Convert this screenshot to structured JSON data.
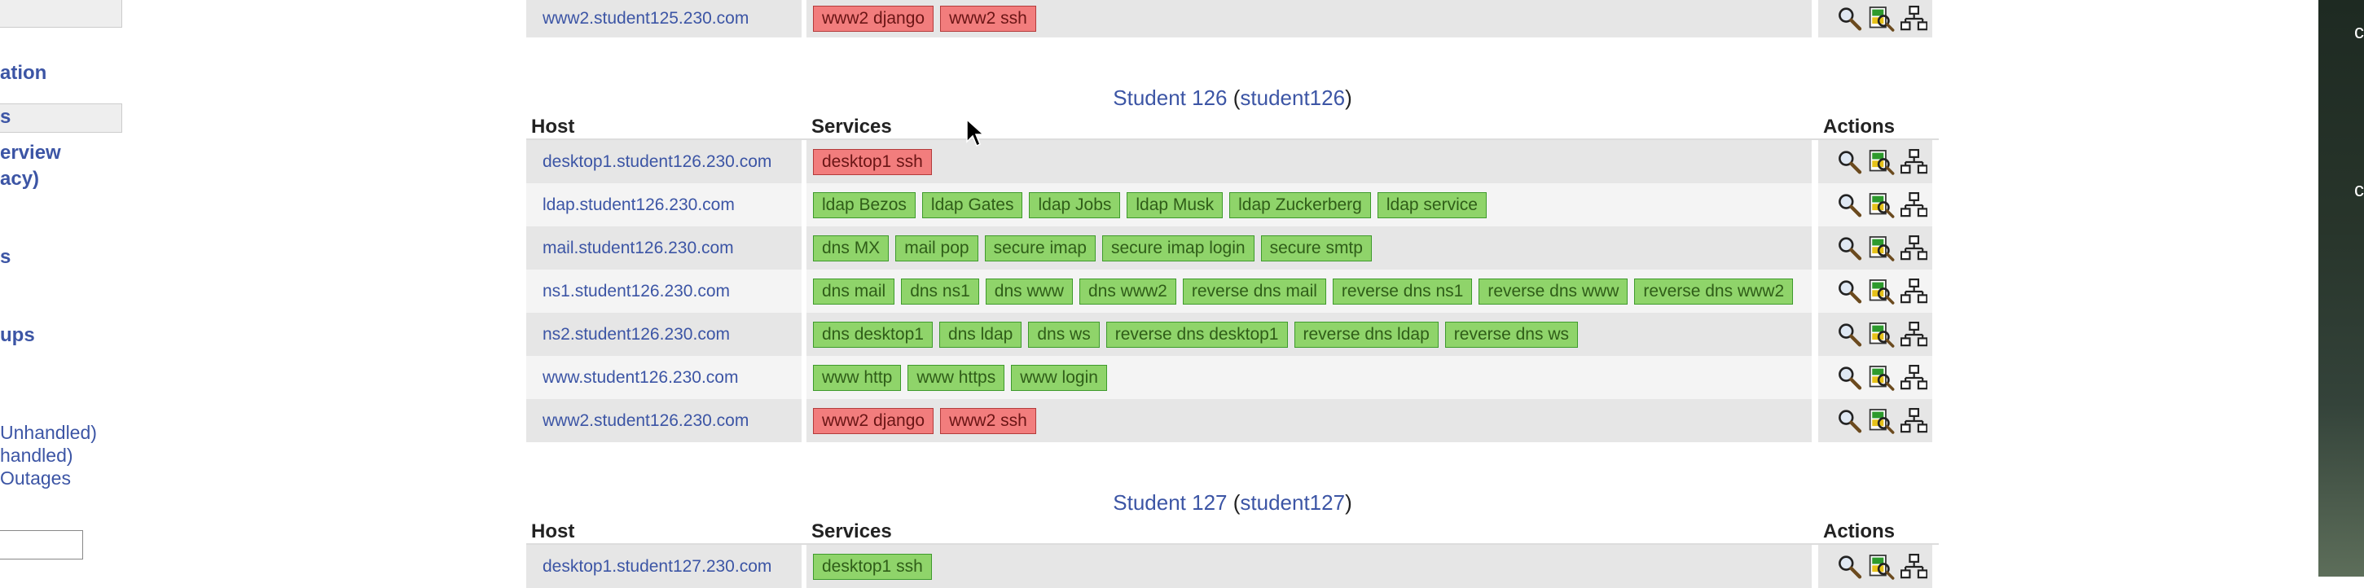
{
  "sidebar": {
    "links": [
      "ation",
      "s",
      "erview",
      "acy)",
      "s",
      "ups"
    ],
    "problems": [
      "Unhandled)",
      "handled)",
      "Outages"
    ]
  },
  "columns": {
    "host": "Host",
    "services": "Services",
    "actions": "Actions"
  },
  "top_row": {
    "host": "www2.student125.230.com",
    "services": [
      {
        "name": "www2 django",
        "state": "critical"
      },
      {
        "name": "www2 ssh",
        "state": "critical"
      }
    ]
  },
  "groups": [
    {
      "name": "Student 126",
      "alias": "student126",
      "rows": [
        {
          "host": "desktop1.student126.230.com",
          "services": [
            {
              "name": "desktop1 ssh",
              "state": "critical"
            }
          ]
        },
        {
          "host": "ldap.student126.230.com",
          "services": [
            {
              "name": "ldap Bezos",
              "state": "ok"
            },
            {
              "name": "ldap Gates",
              "state": "ok"
            },
            {
              "name": "ldap Jobs",
              "state": "ok"
            },
            {
              "name": "ldap Musk",
              "state": "ok"
            },
            {
              "name": "ldap Zuckerberg",
              "state": "ok"
            },
            {
              "name": "ldap service",
              "state": "ok"
            }
          ]
        },
        {
          "host": "mail.student126.230.com",
          "services": [
            {
              "name": "dns MX",
              "state": "ok"
            },
            {
              "name": "mail pop",
              "state": "ok"
            },
            {
              "name": "secure imap",
              "state": "ok"
            },
            {
              "name": "secure imap login",
              "state": "ok"
            },
            {
              "name": "secure smtp",
              "state": "ok"
            }
          ]
        },
        {
          "host": "ns1.student126.230.com",
          "services": [
            {
              "name": "dns mail",
              "state": "ok"
            },
            {
              "name": "dns ns1",
              "state": "ok"
            },
            {
              "name": "dns www",
              "state": "ok"
            },
            {
              "name": "dns www2",
              "state": "ok"
            },
            {
              "name": "reverse dns mail",
              "state": "ok"
            },
            {
              "name": "reverse dns ns1",
              "state": "ok"
            },
            {
              "name": "reverse dns www",
              "state": "ok"
            },
            {
              "name": "reverse dns www2",
              "state": "ok"
            }
          ]
        },
        {
          "host": "ns2.student126.230.com",
          "services": [
            {
              "name": "dns desktop1",
              "state": "ok"
            },
            {
              "name": "dns ldap",
              "state": "ok"
            },
            {
              "name": "dns ws",
              "state": "ok"
            },
            {
              "name": "reverse dns desktop1",
              "state": "ok"
            },
            {
              "name": "reverse dns ldap",
              "state": "ok"
            },
            {
              "name": "reverse dns ws",
              "state": "ok"
            }
          ]
        },
        {
          "host": "www.student126.230.com",
          "services": [
            {
              "name": "www http",
              "state": "ok"
            },
            {
              "name": "www https",
              "state": "ok"
            },
            {
              "name": "www login",
              "state": "ok"
            }
          ]
        },
        {
          "host": "www2.student126.230.com",
          "services": [
            {
              "name": "www2 django",
              "state": "critical"
            },
            {
              "name": "www2 ssh",
              "state": "critical"
            }
          ]
        }
      ]
    },
    {
      "name": "Student 127",
      "alias": "student127",
      "rows": [
        {
          "host": "desktop1.student127.230.com",
          "services": [
            {
              "name": "desktop1 ssh",
              "state": "ok"
            }
          ]
        }
      ]
    }
  ],
  "actions_icons": [
    "magnifier-icon",
    "service-detail-icon",
    "network-map-icon"
  ],
  "right_edge_text": [
    "c",
    "c"
  ],
  "colors": {
    "link": "#3c55a5",
    "ok": "#8fd46a",
    "critical": "#f27d7d"
  }
}
